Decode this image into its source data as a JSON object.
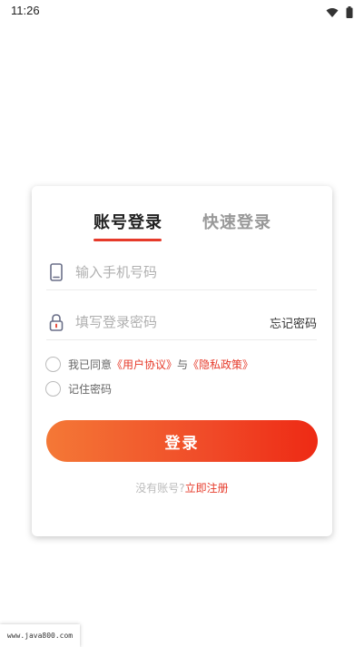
{
  "status_bar": {
    "time": "11:26",
    "icons": [
      "wifi-icon",
      "battery-icon"
    ]
  },
  "login": {
    "tabs": [
      {
        "label": "账号登录",
        "active": true
      },
      {
        "label": "快速登录",
        "active": false
      }
    ],
    "phone": {
      "placeholder": "输入手机号码",
      "value": "",
      "icon": "phone-icon"
    },
    "password": {
      "placeholder": "填写登录密码",
      "value": "",
      "icon": "lock-icon",
      "forgot_label": "忘记密码"
    },
    "agree": {
      "prefix": "我已同意",
      "user_agreement": "《用户协议》",
      "connector": "与",
      "privacy_policy": "《隐私政策》",
      "checked": false
    },
    "remember": {
      "label": "记住密码",
      "checked": false
    },
    "submit_label": "登录",
    "register": {
      "prompt": "没有账号?",
      "link": "立即注册"
    }
  },
  "watermark": "www.java800.com",
  "colors": {
    "accent": "#e63a2a",
    "button_start": "#f47836",
    "button_end": "#ee2a14"
  }
}
